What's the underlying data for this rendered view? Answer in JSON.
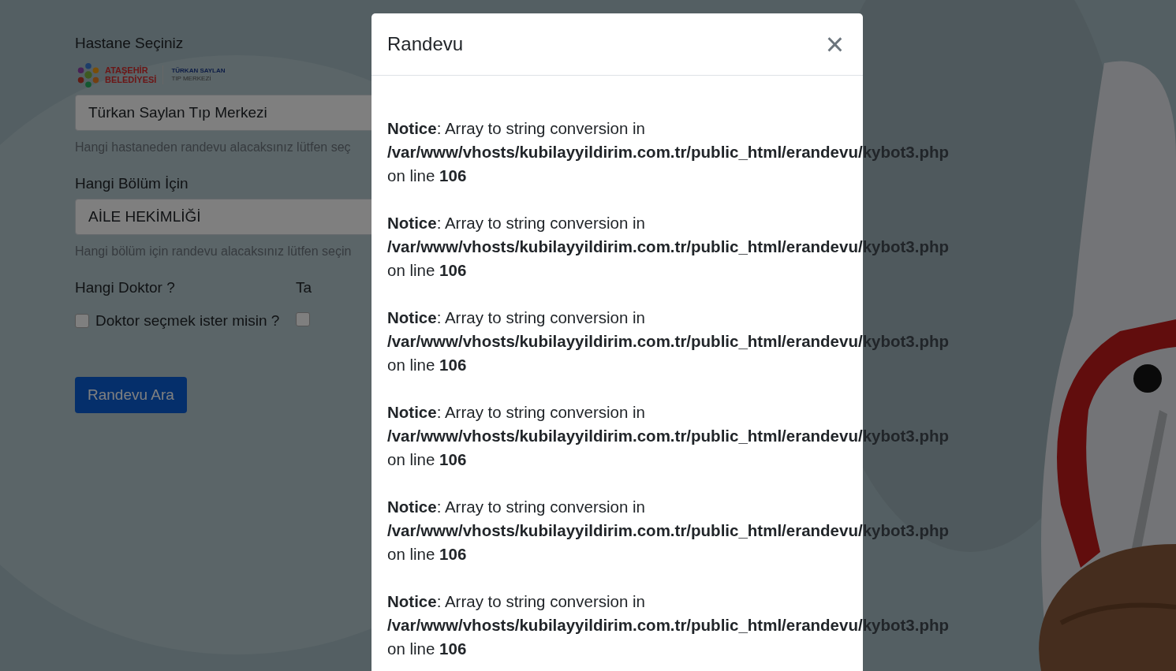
{
  "form": {
    "hospital": {
      "label": "Hastane Seçiniz",
      "logo": {
        "city_lines": [
          "ATAŞEHİR",
          "BELEDİYESİ"
        ],
        "center_lines": [
          "TÜRKAN SAYLAN",
          "TIP MERKEZİ"
        ]
      },
      "value": "Türkan Saylan Tıp Merkezi",
      "help": "Hangi hastaneden randevu alacaksınız lütfen seç"
    },
    "department": {
      "label": "Hangi Bölüm İçin",
      "value": "AİLE HEKİMLİĞİ",
      "help": "Hangi bölüm için randevu alacaksınız lütfen seçin"
    },
    "options": [
      {
        "label": "Hangi Doktor ?",
        "checkbox": "Doktor seçmek ister misin ?",
        "checked": false
      },
      {
        "label": "Ta",
        "checked": false
      }
    ],
    "button": "Randevu Ara"
  },
  "modal": {
    "title": "Randevu",
    "close": "×",
    "notices": [
      "**Notice**: Array to string conversion in **/var/www/vhosts/kubilayyildirim.com.tr/public_html/erandevu/kybot3.php** on line **106**",
      "**Notice**: Array to string conversion in **/var/www/vhosts/kubilayyildirim.com.tr/public_html/erandevu/kybot3.php** on line **106**",
      "**Notice**: Array to string conversion in **/var/www/vhosts/kubilayyildirim.com.tr/public_html/erandevu/kybot3.php** on line **106**",
      "**Notice**: Array to string conversion in **/var/www/vhosts/kubilayyildirim.com.tr/public_html/erandevu/kybot3.php** on line **106**",
      "**Notice**: Array to string conversion in **/var/www/vhosts/kubilayyildirim.com.tr/public_html/erandevu/kybot3.php** on line **106**",
      "**Notice**: Array to string conversion in **/var/www/vhosts/kubilayyildirim.com.tr/public_html/erandevu/kybot3.php** on line **106**"
    ]
  }
}
